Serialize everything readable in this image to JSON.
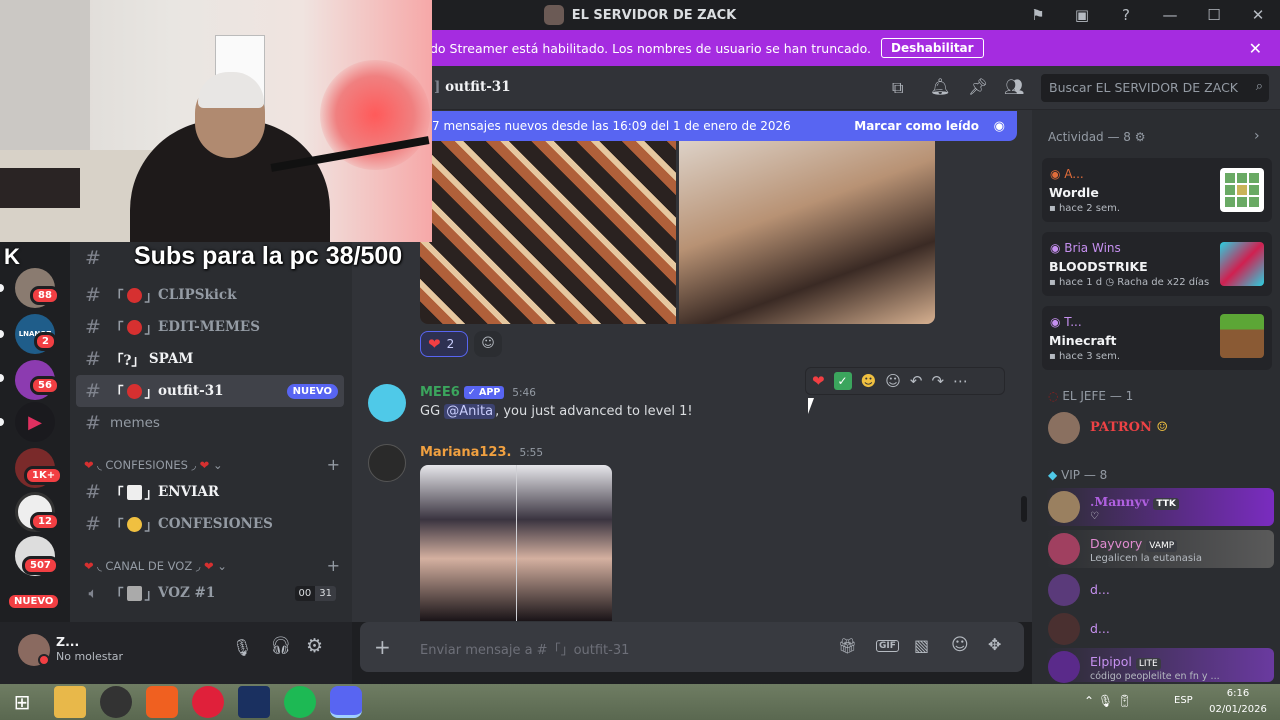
{
  "window": {
    "title": "EL SERVIDOR DE ZACK"
  },
  "banner": {
    "text": "do Streamer está habilitado. Los nombres de usuario se han truncado.",
    "button": "Deshabilitar"
  },
  "channel_header": {
    "name": "outfit-31",
    "search_placeholder": "Buscar EL SERVIDOR DE ZACK"
  },
  "overlay": {
    "text": "Subs para la pc 38/500"
  },
  "servers": [
    {
      "badge": "88"
    },
    {
      "label": "LNANOZ",
      "badge": "2"
    },
    {
      "badge": "56"
    },
    {},
    {
      "badge": "1K+"
    },
    {
      "badge": "12"
    },
    {
      "badge": "507"
    },
    {
      "badge": "NUEVO"
    }
  ],
  "channels": [
    {
      "name": "CLIPSkick",
      "prefix": "「",
      "suffix": "」"
    },
    {
      "name": "EDIT-MEMES",
      "prefix": "「",
      "suffix": "」"
    },
    {
      "name": "SPAM",
      "prefix": "「?」",
      "suffix": ""
    },
    {
      "name": "outfit-31",
      "prefix": "「",
      "suffix": "」",
      "badge": "NUEVO"
    },
    {
      "name": "memes"
    }
  ],
  "categories": [
    {
      "name": "CONFESIONES"
    },
    {
      "name": "CANAL DE VOZ"
    }
  ],
  "channels2": [
    {
      "name": "ENVIAR",
      "prefix": "「",
      "suffix": "」"
    },
    {
      "name": "CONFESIONES",
      "prefix": "「",
      "suffix": "」"
    }
  ],
  "voice": {
    "name": "VOZ #1",
    "prefix": "「",
    "suffix": "」",
    "count": "00",
    "limit": "31"
  },
  "user": {
    "name": "Z...",
    "status": "No molestar"
  },
  "new_messages": {
    "text": "7 mensajes nuevos desde las 16:09 del 1 de enero de 2026",
    "action": "Marcar como leído"
  },
  "messages": [
    {
      "author": "MEE6",
      "tag": "✓ APP",
      "time": "5:46",
      "text_before": "GG ",
      "mention": "@Anita",
      "text_after": ", you just advanced to level 1!"
    },
    {
      "author": "Mariana123.",
      "time": "5:55"
    }
  ],
  "reaction": {
    "count": "2"
  },
  "composer": {
    "placeholder": "Enviar mensaje a #「」outfit-31"
  },
  "activity": {
    "title": "Actividad — 8",
    "cards": [
      {
        "user": "A...",
        "game": "Wordle",
        "time": "hace 2 sem."
      },
      {
        "user": "Bria Wins",
        "game": "BLOODSTRIKE",
        "time": "hace 1 d",
        "extra": "Racha de x22 días"
      },
      {
        "user": "T...",
        "game": "Minecraft",
        "time": "hace 3 sem."
      }
    ]
  },
  "groups": [
    {
      "name": "EL JEFE — 1"
    },
    {
      "name": "VIP — 8"
    }
  ],
  "members": [
    {
      "name": "PATRON",
      "color": "#ed4245"
    },
    {
      "name": ".Mannyv",
      "tag": "TTK",
      "status": "♡",
      "color": "#b060e0"
    },
    {
      "name": "Dayvory",
      "tag": "VAMP",
      "status": "Legalicen la eutanasia",
      "color": "#e08bd0"
    },
    {
      "name": "d...",
      "color": "#c690f0"
    },
    {
      "name": "d...",
      "color": "#c690f0"
    },
    {
      "name": "Elpipol",
      "tag": "LITE",
      "status": "código peoplelite en fn y ...",
      "color": "#c690f0"
    }
  ],
  "taskbar": {
    "lang": "ESP",
    "time": "6:16",
    "date": "02/01/2026"
  },
  "colors": {
    "accent": "#5865f2",
    "banner": "#a52ce0",
    "background": "#313338"
  }
}
